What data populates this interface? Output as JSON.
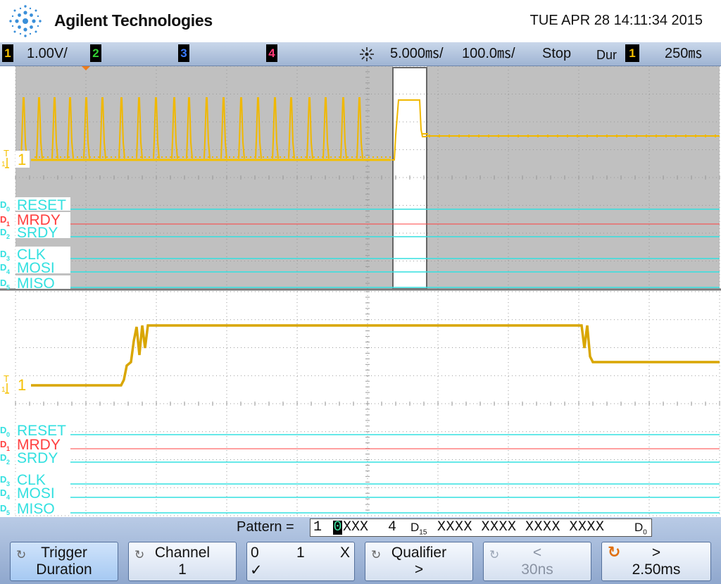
{
  "header": {
    "brand": "Agilent Technologies",
    "datetime": "TUE APR 28 14:11:34 2015"
  },
  "status": {
    "ch1": {
      "num": "1",
      "scale": "1.00V/",
      "color": "#f5c000"
    },
    "ch2": {
      "num": "2",
      "color": "#33d033"
    },
    "ch3": {
      "num": "3",
      "color": "#3a7bff"
    },
    "ch4": {
      "num": "4",
      "color": "#ff3a7a"
    },
    "delay": "5.000㎳/",
    "timebase": "100.0㎳/",
    "run_state": "Stop",
    "meas_label": "Dur",
    "meas_channel": "1",
    "meas_value": "250㎳"
  },
  "upper": {
    "channel_marker": "1",
    "trig_label": "T",
    "digital": [
      {
        "num": "0",
        "name": "RESET",
        "color": "#33e0e0"
      },
      {
        "num": "1",
        "name": "MRDY",
        "color": "#ff4040"
      },
      {
        "num": "2",
        "name": "SRDY",
        "color": "#33e0e0"
      },
      {
        "num": "3",
        "name": "CLK",
        "color": "#33e0e0"
      },
      {
        "num": "4",
        "name": "MOSI",
        "color": "#33e0e0"
      },
      {
        "num": "5",
        "name": "MISO",
        "color": "#33e0e0"
      }
    ]
  },
  "lower": {
    "channel_marker": "1",
    "trig_label": "T",
    "digital": [
      {
        "num": "0",
        "name": "RESET",
        "color": "#33e0e0"
      },
      {
        "num": "1",
        "name": "MRDY",
        "color": "#ff4040"
      },
      {
        "num": "2",
        "name": "SRDY",
        "color": "#33e0e0"
      },
      {
        "num": "3",
        "name": "CLK",
        "color": "#33e0e0"
      },
      {
        "num": "4",
        "name": "MOSI",
        "color": "#33e0e0"
      },
      {
        "num": "5",
        "name": "MISO",
        "color": "#33e0e0"
      }
    ]
  },
  "pattern": {
    "label": "Pattern =",
    "ch_first": "1",
    "bit_selected": "0",
    "bits_analog": "XXX",
    "ch_last": "4",
    "d15_label": "D",
    "d15_sub": "15",
    "digital_bits": "XXXX XXXX XXXX XXXX",
    "d0_label": "D",
    "d0_sub": "0"
  },
  "softkeys": [
    {
      "line1": "Trigger",
      "line2": "Duration",
      "active": true
    },
    {
      "line1": "Channel",
      "line2": "1"
    },
    {
      "v0": "0",
      "v1": "1",
      "vx": "X",
      "check": "✓"
    },
    {
      "line1": "Qualifier",
      "line2": ">"
    },
    {
      "line1": "<",
      "line2": "30ns",
      "disabled": true
    },
    {
      "line1": ">",
      "line2": "2.50ms"
    }
  ],
  "colors": {
    "analog": "#f0b800",
    "digital_cyan": "#33e0e0",
    "digital_red": "#ff4040",
    "grid": "#9a9a9a"
  }
}
